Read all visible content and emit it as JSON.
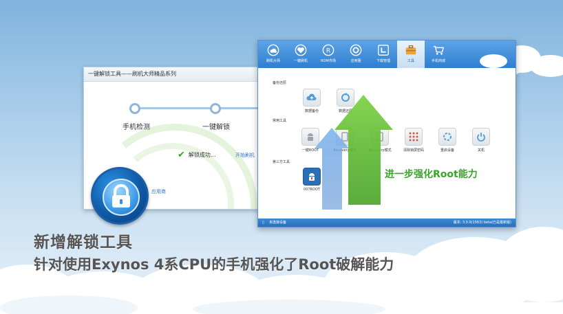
{
  "unlock_window": {
    "title": "一键解锁工具——刷机大师精品系列",
    "steps": [
      "手机检测",
      "一键解锁"
    ],
    "status": "解锁成功...",
    "start_link": "开始刷机",
    "apply_link": "应用商"
  },
  "main_window": {
    "toolbar": [
      {
        "label": "刷机大师",
        "icon": "cloud-icon"
      },
      {
        "label": "一键刷机",
        "icon": "heart-icon"
      },
      {
        "label": "ROM市场",
        "icon": "rom-icon"
      },
      {
        "label": "应用圈",
        "icon": "app-icon"
      },
      {
        "label": "下载管理",
        "icon": "download-icon"
      },
      {
        "label": "工具",
        "icon": "toolbox-icon",
        "active": true
      },
      {
        "label": "手机商城",
        "icon": "cart-icon"
      }
    ],
    "sections": {
      "backup": "备份还原",
      "common": "常用工具",
      "third_party": "第三方工具"
    },
    "backup_items": [
      "数据备份",
      "数据还原"
    ],
    "common_items": [
      "一键ROOT",
      "Recovery模式",
      "Recovery模式",
      "清除锁屏密码",
      "重启设备",
      "关机"
    ],
    "third_items": [
      "007ROOT"
    ],
    "status_left": "未连接设备",
    "status_right": "版本: 3.0.9(1563) beta(已是最新版)"
  },
  "callout": "进一步强化Root能力",
  "captions": {
    "line1": "新增解锁工具",
    "line2": "针对使用Exynos 4系CPU的手机强化了Root破解能力"
  },
  "colors": {
    "accent_blue": "#2f7fd1",
    "arrow_green": "#5cbf2a",
    "arrow_blue": "#6fa8e3"
  }
}
